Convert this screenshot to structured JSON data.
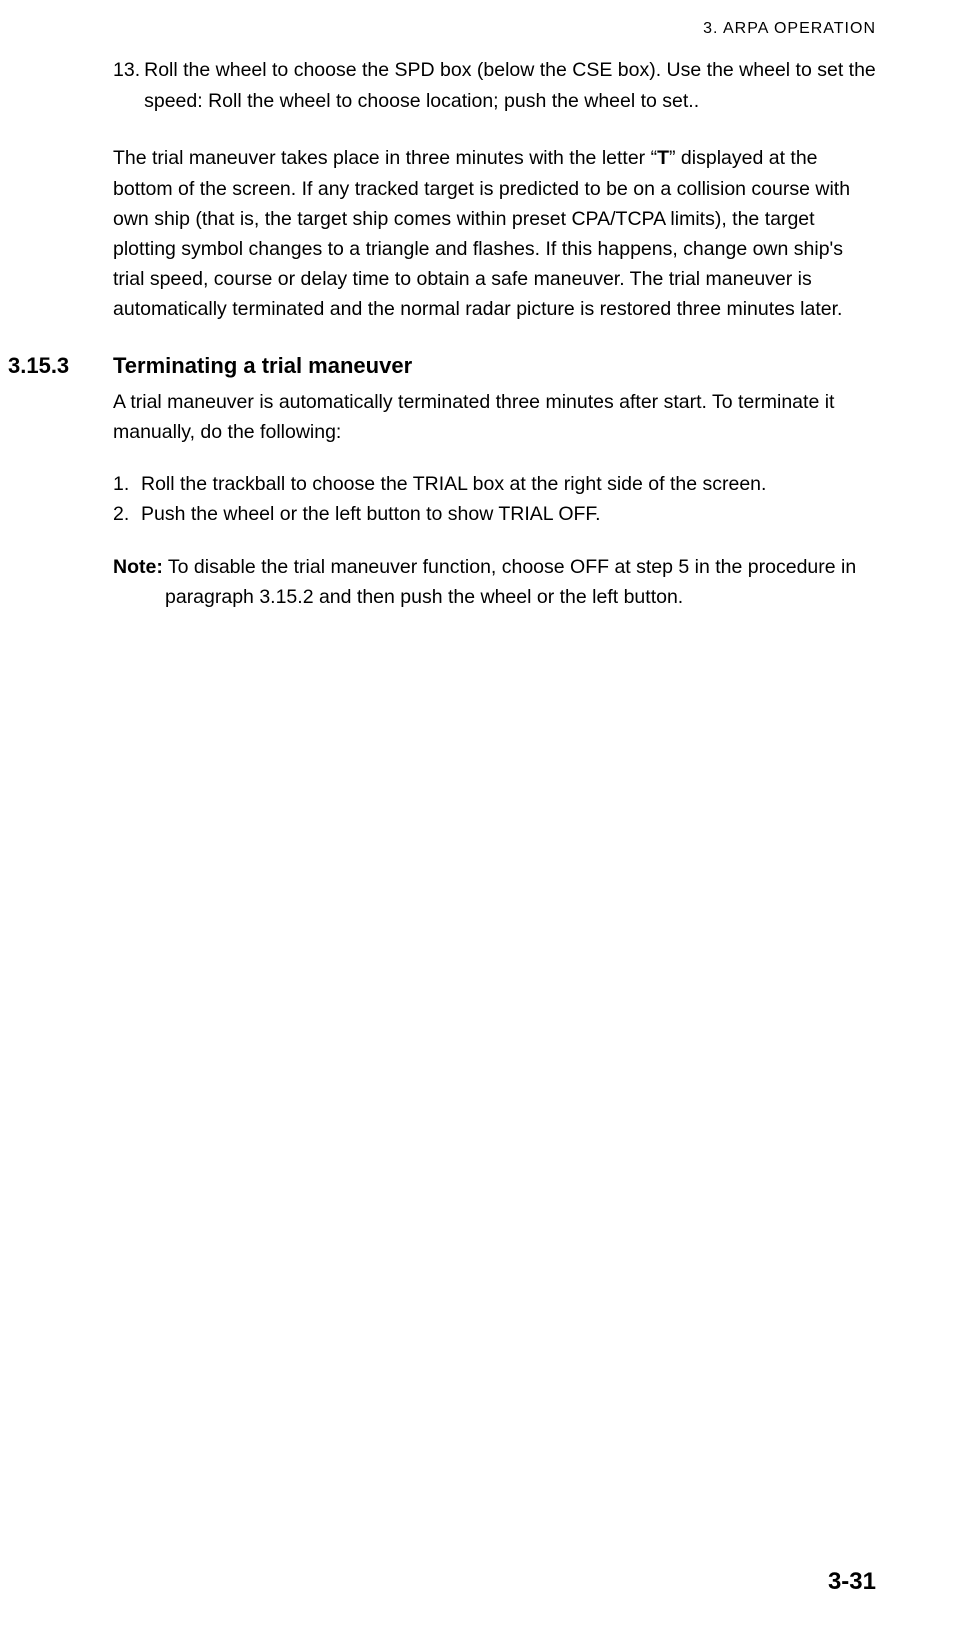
{
  "header": "3.  ARPA  OPERATION",
  "step13": {
    "num": "13.",
    "text": "Roll the wheel to choose the SPD box (below the CSE box). Use the wheel to set the speed: Roll the wheel to choose location; push the wheel to set.."
  },
  "paragraph1_pre": "The trial maneuver takes place in three minutes with the letter “",
  "paragraph1_bold": "T",
  "paragraph1_post": "” displayed at the bottom of the screen. If any tracked target is predicted to be on a collision course with own ship (that is, the target ship comes within preset CPA/TCPA limits), the target plotting symbol changes to a triangle and flashes. If this happens, change own ship's trial speed, course or delay time to obtain a safe maneuver. The trial maneuver is automatically terminated and the normal radar picture is restored three minutes later.",
  "section": {
    "num": "3.15.3",
    "title": "Terminating a trial maneuver",
    "intro": "A trial maneuver is automatically terminated three minutes after start. To terminate it manually, do the following:",
    "items": [
      {
        "num": "1.",
        "text": "Roll the trackball to choose the TRIAL box at the right side of the screen."
      },
      {
        "num": "2.",
        "text": "Push the wheel or the left button to show TRIAL OFF."
      }
    ],
    "note_label": "Note:",
    "note_text": " To disable the trial maneuver function, choose OFF at step 5 in the procedure in paragraph 3.15.2 and then push the wheel or the left button."
  },
  "pageNumber": "3-31"
}
